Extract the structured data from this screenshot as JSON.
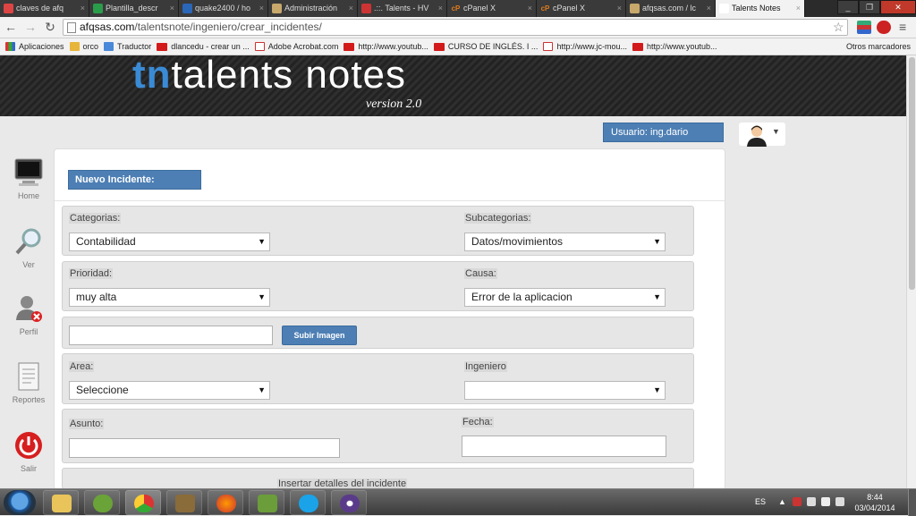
{
  "browser": {
    "tabs": [
      {
        "label": "claves de afq",
        "favicon_color": "#d44"
      },
      {
        "label": "Plantilla_descr",
        "favicon_color": "#2a9d4b"
      },
      {
        "label": "quake2400 / ho",
        "favicon_color": "#2a67b8"
      },
      {
        "label": "Administración",
        "favicon_color": "#c8a86b"
      },
      {
        "label": ".::. Talents - HV",
        "favicon_color": "#c33"
      },
      {
        "label": "cPanel X",
        "favicon_color": "#e07a1a",
        "favicon_text": "cP"
      },
      {
        "label": "cPanel X",
        "favicon_color": "#e07a1a",
        "favicon_text": "cP"
      },
      {
        "label": "afqsas.com / lc",
        "favicon_color": "#c8a86b"
      },
      {
        "label": "Talents Notes",
        "favicon_color": "#fff",
        "active": true
      }
    ],
    "url_host": "afqsas.com",
    "url_path": "/talentsnote/ingeniero/crear_incidentes/",
    "bookmarks": [
      {
        "label": "Aplicaciones",
        "icon": "apps"
      },
      {
        "label": "orco",
        "icon": "folder"
      },
      {
        "label": "Traductor",
        "icon": "trad"
      },
      {
        "label": "dlancedu - crear un ...",
        "icon": "yt"
      },
      {
        "label": "Adobe Acrobat.com",
        "icon": "pdf"
      },
      {
        "label": "http://www.youtub...",
        "icon": "yt"
      },
      {
        "label": "CURSO DE INGLÉS. I ...",
        "icon": "yt"
      },
      {
        "label": "http://www.jc-mou...",
        "icon": "pdf"
      },
      {
        "label": "http://www.youtub...",
        "icon": "yt"
      }
    ],
    "bookmarks_other": "Otros marcadores"
  },
  "header": {
    "logo_tn": "tn",
    "logo_text": "talents notes",
    "version": "version 2.0"
  },
  "user": {
    "label": "Usuario: ing.dario"
  },
  "sidebar": [
    {
      "label": "Home",
      "icon": "monitor-icon"
    },
    {
      "label": "Ver",
      "icon": "magnifier-icon"
    },
    {
      "label": "Perfil",
      "icon": "user-remove-icon"
    },
    {
      "label": "Reportes",
      "icon": "document-icon"
    },
    {
      "label": "Salir",
      "icon": "power-icon"
    }
  ],
  "form": {
    "title": "Nuevo Incidente:",
    "categorias_label": "Categorias:",
    "categorias_value": "Contabilidad",
    "subcategorias_label": "Subcategorias:",
    "subcategorias_value": "Datos/movimientos",
    "prioridad_label": "Prioridad:",
    "prioridad_value": "muy alta",
    "causa_label": "Causa:",
    "causa_value": "Error de la aplicacion",
    "upload_button": "Subir Imagen",
    "area_label": "Area:",
    "area_value": "Seleccione",
    "ingeniero_label": "Ingeniero",
    "ingeniero_value": "",
    "asunto_label": "Asunto:",
    "fecha_label": "Fecha:",
    "detalles_label": "Insertar detalles del incidente"
  },
  "taskbar": {
    "language": "ES",
    "time": "8:44",
    "date": "03/04/2014"
  }
}
